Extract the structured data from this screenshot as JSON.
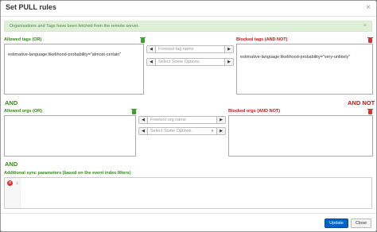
{
  "modal": {
    "title": "Set PULL rules",
    "close_glyph": "×"
  },
  "alert": {
    "message": "Organisations and Tags have been fetched from the remote server.",
    "close_glyph": "×"
  },
  "tags": {
    "allowed_label": "Allowed tags (OR)",
    "blocked_label": "Blocked tags (AND NOT)",
    "allowed_rule": "estimative-language:likelihood-probability=\"almost-certain\"",
    "blocked_rule": "estimative-language:likelihood-probability=\"very-unlikely\"",
    "freetext_placeholder": "Freetext tag name",
    "select_placeholder": "Select Some Options"
  },
  "and_label": "AND",
  "and_not_label": "AND NOT",
  "orgs": {
    "allowed_label": "Allowed orgs (OR)",
    "blocked_label": "Blocked orgs (AND NOT)",
    "freetext_placeholder": "Freetext org name",
    "select_placeholder": "Select Some Options"
  },
  "and_label_2": "AND",
  "sync": {
    "label": "Additional sync parameters (based on the event index filters)",
    "error_glyph": "x",
    "line_number": "1"
  },
  "footer": {
    "update_label": "Update",
    "close_label": "Close"
  },
  "arrows": {
    "left": "◀",
    "right": "▶",
    "caret": "▼"
  },
  "colors": {
    "allowed": "#2e8b14",
    "blocked": "#c81414",
    "primary": "#0063c5"
  }
}
